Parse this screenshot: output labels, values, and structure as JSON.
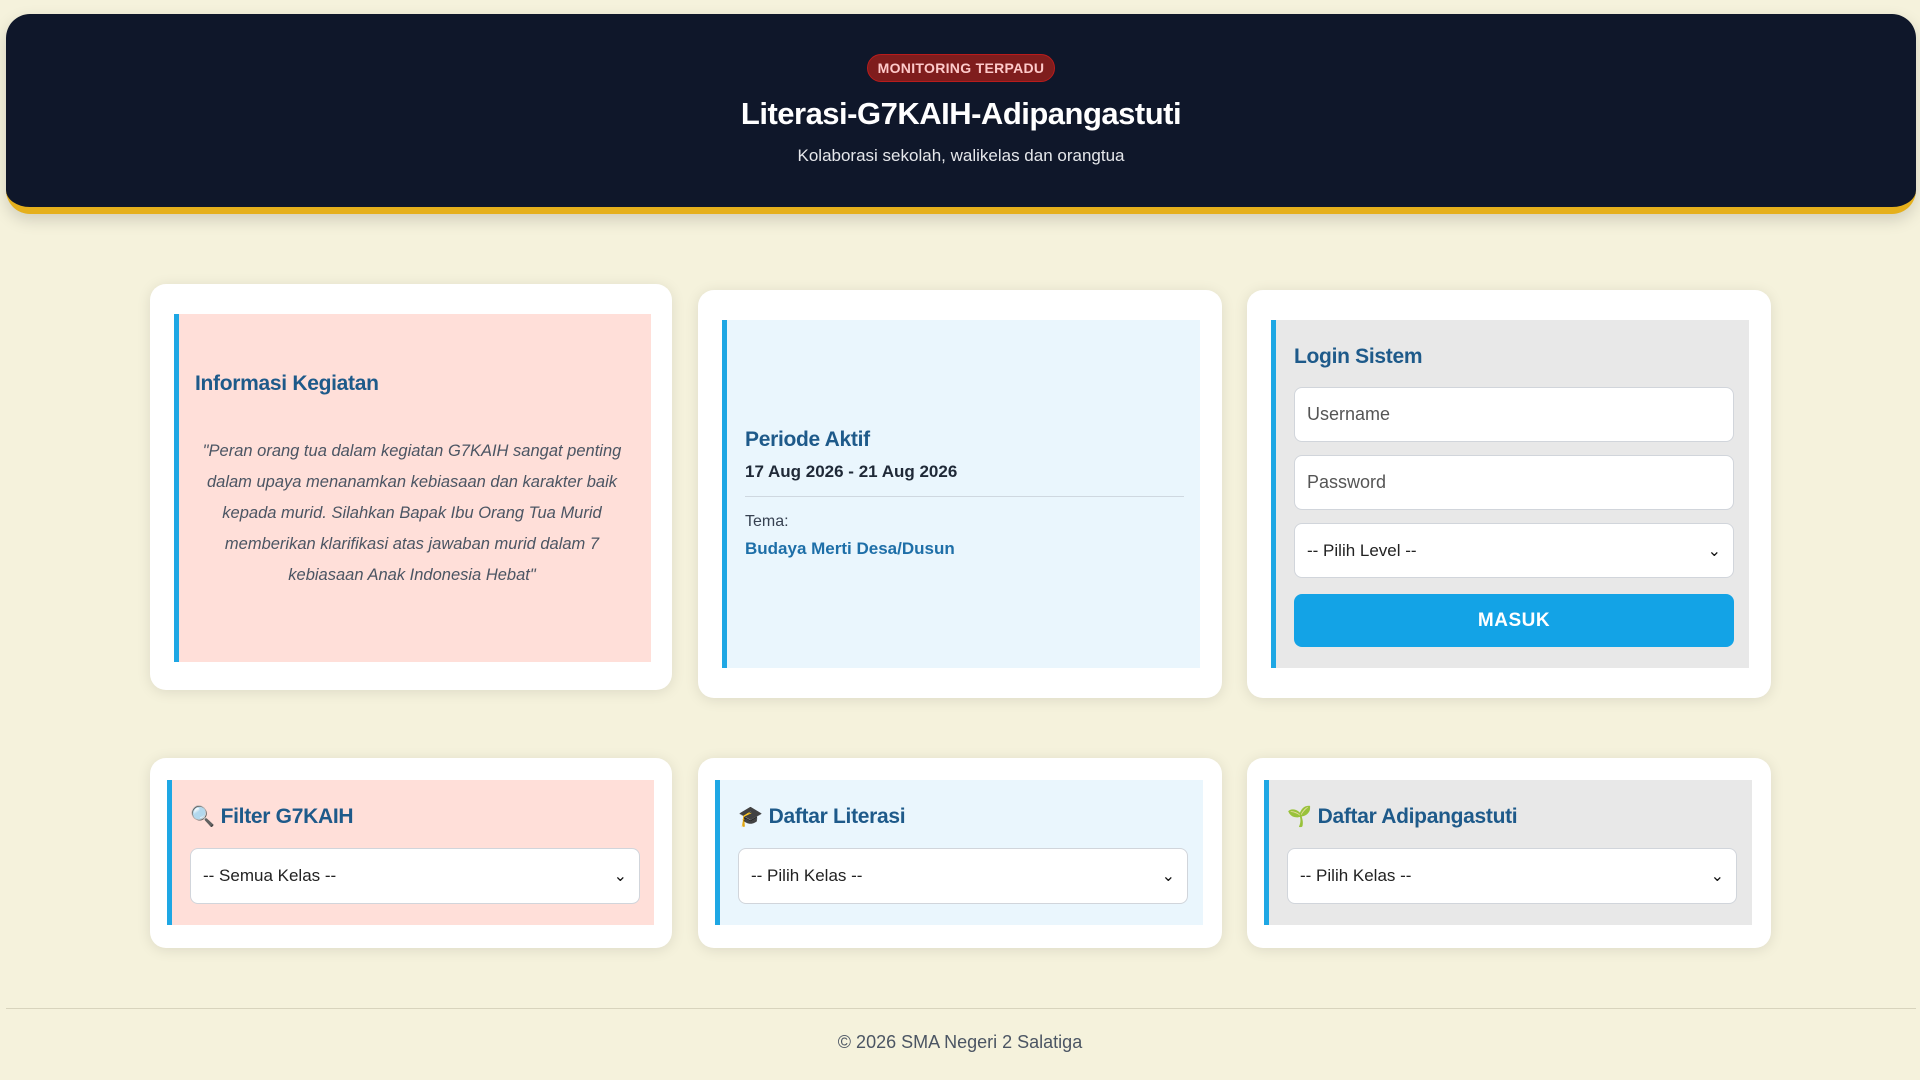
{
  "header": {
    "badge": "MONITORING TERPADU",
    "title": "Literasi-G7KAIH-Adipangastuti",
    "subtitle": "Kolaborasi sekolah, walikelas dan orangtua"
  },
  "info": {
    "heading": "Informasi Kegiatan",
    "quote": "\"Peran orang tua dalam kegiatan G7KAIH sangat penting dalam upaya menanamkan kebiasaan dan karakter baik kepada murid. Silahkan Bapak Ibu Orang Tua Murid memberikan klarifikasi atas jawaban murid dalam 7 kebiasaan Anak Indonesia Hebat\""
  },
  "period": {
    "heading": "Periode Aktif",
    "date": "17 Aug 2026 - 21 Aug 2026",
    "tema_label": "Tema:",
    "tema_value": "Budaya Merti Desa/Dusun"
  },
  "login": {
    "heading": "Login Sistem",
    "username_placeholder": "Username",
    "password_placeholder": "Password",
    "level_selected": "-- Pilih Level --",
    "submit_label": "MASUK"
  },
  "filter": {
    "heading": "Filter G7KAIH",
    "selected": "-- Semua Kelas --"
  },
  "literasi": {
    "heading": "Daftar Literasi",
    "selected": "-- Pilih Kelas --"
  },
  "adipangastuti": {
    "heading": "Daftar Adipangastuti",
    "selected": "-- Pilih Kelas --"
  },
  "footer": {
    "text": "© 2026 SMA Negeri 2 Salatiga"
  },
  "colors": {
    "header_bg": "#0f172a",
    "accent_gold": "#e5b01c",
    "accent_blue": "#1ea7e4",
    "button_blue": "#13a3e6",
    "heading_blue": "#1e5a8a"
  }
}
